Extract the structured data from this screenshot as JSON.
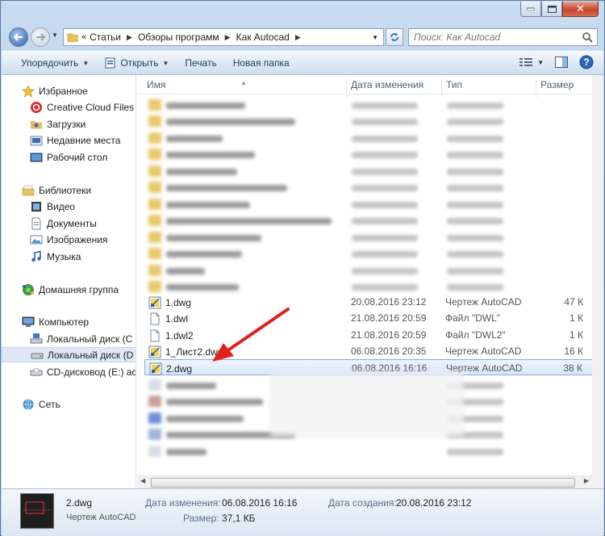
{
  "address": {
    "segments": [
      "Статьи",
      "Обзоры программ",
      "Как Autocad"
    ],
    "search_placeholder": "Поиск: Как Autocad"
  },
  "toolbar": {
    "organize": "Упорядочить",
    "open": "Открыть",
    "print": "Печать",
    "new_folder": "Новая папка"
  },
  "nav": {
    "favorites": "Избранное",
    "creative_cloud": "Creative Cloud Files",
    "downloads": "Загрузки",
    "recent": "Недавние места",
    "desktop": "Рабочий стол",
    "libraries": "Библиотеки",
    "video": "Видео",
    "documents": "Документы",
    "images": "Изображения",
    "music": "Музыка",
    "homegroup": "Домашняя группа",
    "computer": "Компьютер",
    "local_c": "Локальный диск (C",
    "local_d": "Локальный диск (D",
    "cd": "CD-дисковод (E:) ac",
    "network": "Сеть"
  },
  "columns": {
    "name": "Имя",
    "date": "Дата изменения",
    "type": "Тип",
    "size": "Размер"
  },
  "files": [
    {
      "name": "1.dwg",
      "date": "20.08.2016 23:12",
      "type": "Чертеж AutoCAD",
      "size": "47 К"
    },
    {
      "name": "1.dwl",
      "date": "21.08.2016 20:59",
      "type": "Файл \"DWL\"",
      "size": "1 К"
    },
    {
      "name": "1.dwl2",
      "date": "21.08.2016 20:59",
      "type": "Файл \"DWL2\"",
      "size": "1 К"
    },
    {
      "name": "1_Лист2.dwg",
      "date": "06.08.2016 20:35",
      "type": "Чертеж AutoCAD",
      "size": "16 К"
    },
    {
      "name": "2.dwg",
      "date": "06.08.2016 16:16",
      "type": "Чертеж AutoCAD",
      "size": "38 К"
    }
  ],
  "details": {
    "name": "2.dwg",
    "type": "Чертеж AutoCAD",
    "modified_label": "Дата изменения:",
    "modified_value": "06.08.2016 16:16",
    "created_label": "Дата создания:",
    "created_value": "20.08.2016 23:12",
    "size_label": "Размер:",
    "size_value": "37,1 КБ"
  },
  "colors": {
    "selection_border": "#84acdd",
    "annotation_arrow": "#e0201a",
    "toolbar_text": "#1e395b"
  }
}
